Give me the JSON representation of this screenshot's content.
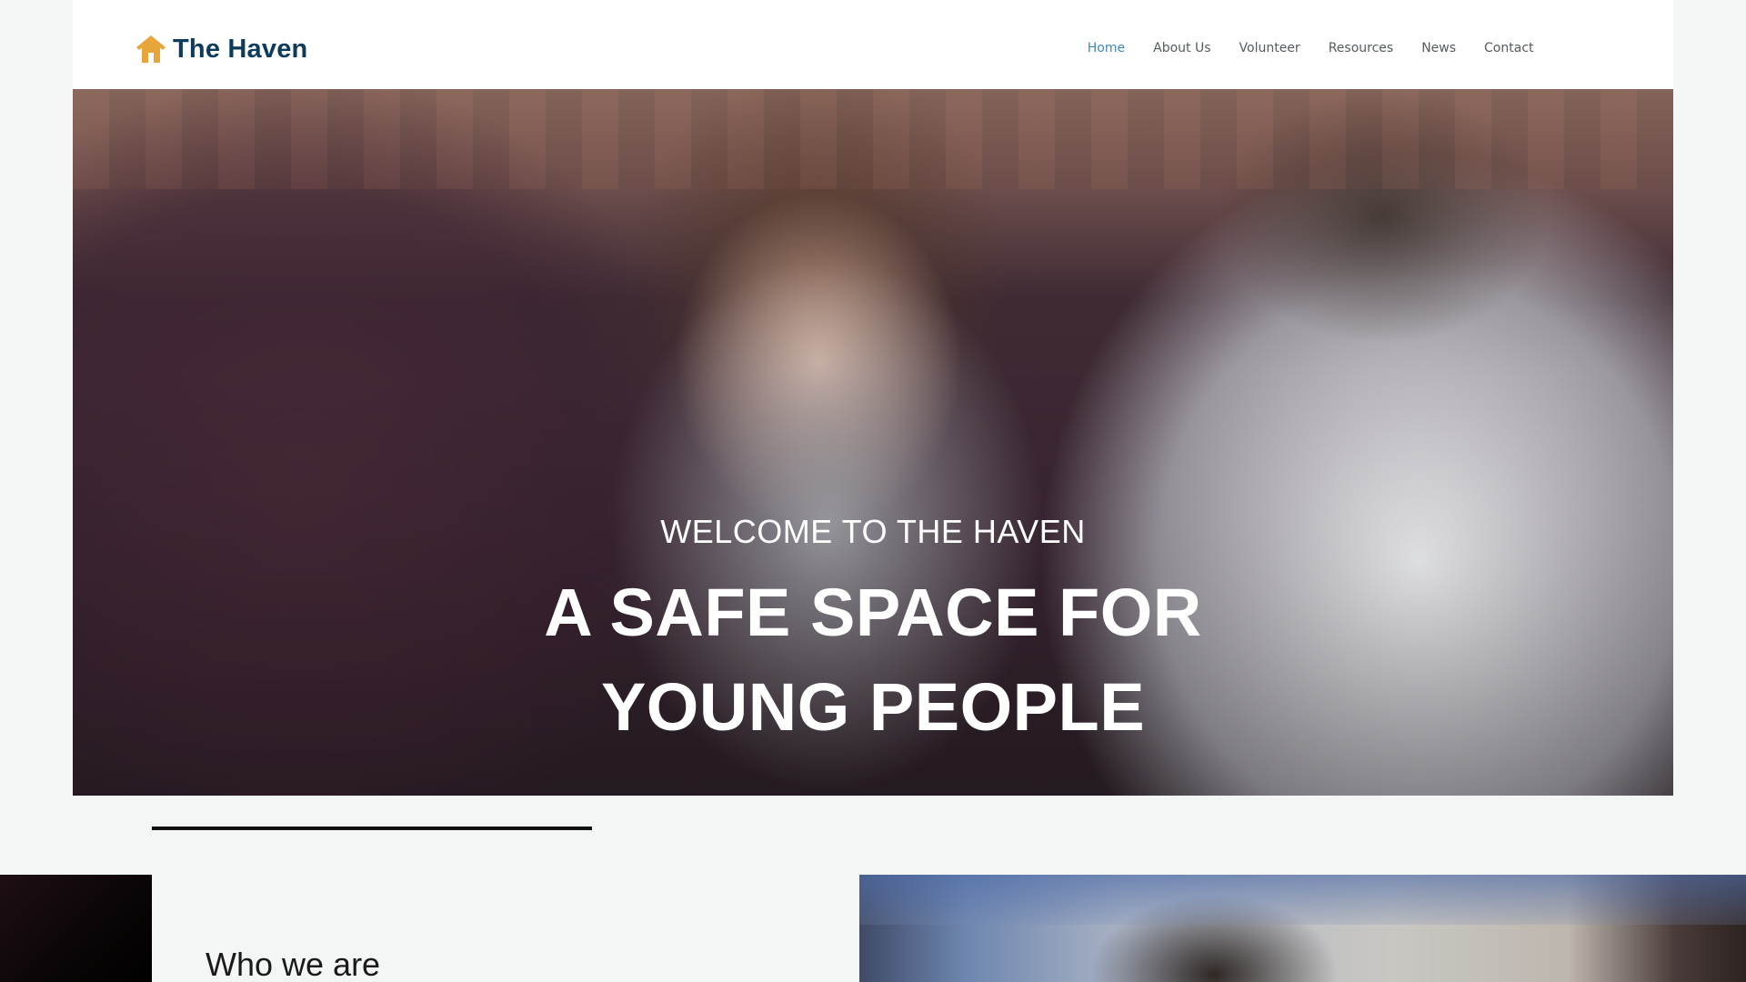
{
  "site": {
    "brand": "The Haven",
    "colors": {
      "brand_text": "#0d3b5c",
      "logo_icon": "#e8a53a",
      "nav_active": "#3d88bf",
      "nav_text": "#555b5e"
    },
    "logo_icon": "house-icon"
  },
  "nav": {
    "items": [
      {
        "label": "Home",
        "active": true
      },
      {
        "label": "About Us",
        "active": false
      },
      {
        "label": "Volunteer",
        "active": false
      },
      {
        "label": "Resources",
        "active": false
      },
      {
        "label": "News",
        "active": false
      },
      {
        "label": "Contact",
        "active": false
      }
    ]
  },
  "hero": {
    "kicker": "WELCOME TO THE HAVEN",
    "headline_line1": "A SAFE SPACE FOR",
    "headline_line2": "YOUNG PEOPLE"
  },
  "section": {
    "title": "Who we are"
  }
}
